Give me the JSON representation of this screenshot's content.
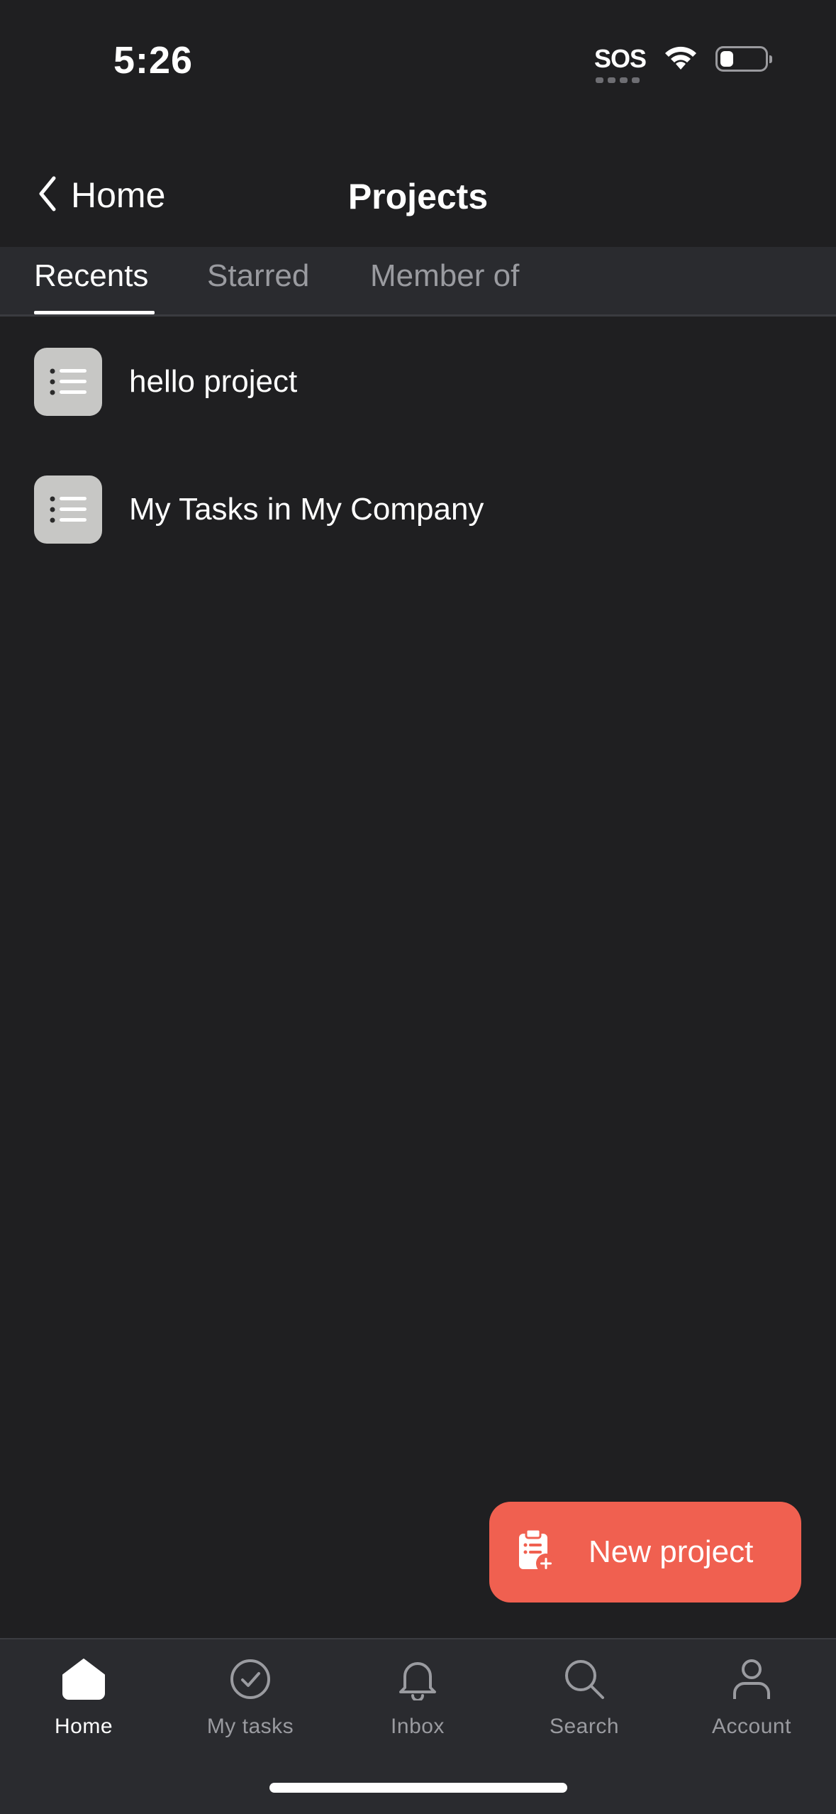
{
  "status_bar": {
    "time": "5:26",
    "sos": "SOS",
    "battery_level": 0.3
  },
  "nav": {
    "back_label": "Home",
    "title": "Projects"
  },
  "tabs": [
    {
      "label": "Recents",
      "active": true
    },
    {
      "label": "Starred",
      "active": false
    },
    {
      "label": "Member of",
      "active": false
    }
  ],
  "projects": [
    {
      "name": "hello project",
      "icon": "list-icon"
    },
    {
      "name": "My Tasks in My Company",
      "icon": "list-icon"
    }
  ],
  "fab": {
    "label": "New project",
    "icon": "clipboard-plus-icon",
    "color": "#f06050"
  },
  "tab_bar": {
    "items": [
      {
        "label": "Home",
        "icon": "home-icon",
        "active": true
      },
      {
        "label": "My tasks",
        "icon": "check-circle-icon",
        "active": false
      },
      {
        "label": "Inbox",
        "icon": "bell-icon",
        "active": false
      },
      {
        "label": "Search",
        "icon": "search-icon",
        "active": false
      },
      {
        "label": "Account",
        "icon": "person-icon",
        "active": false
      }
    ]
  }
}
